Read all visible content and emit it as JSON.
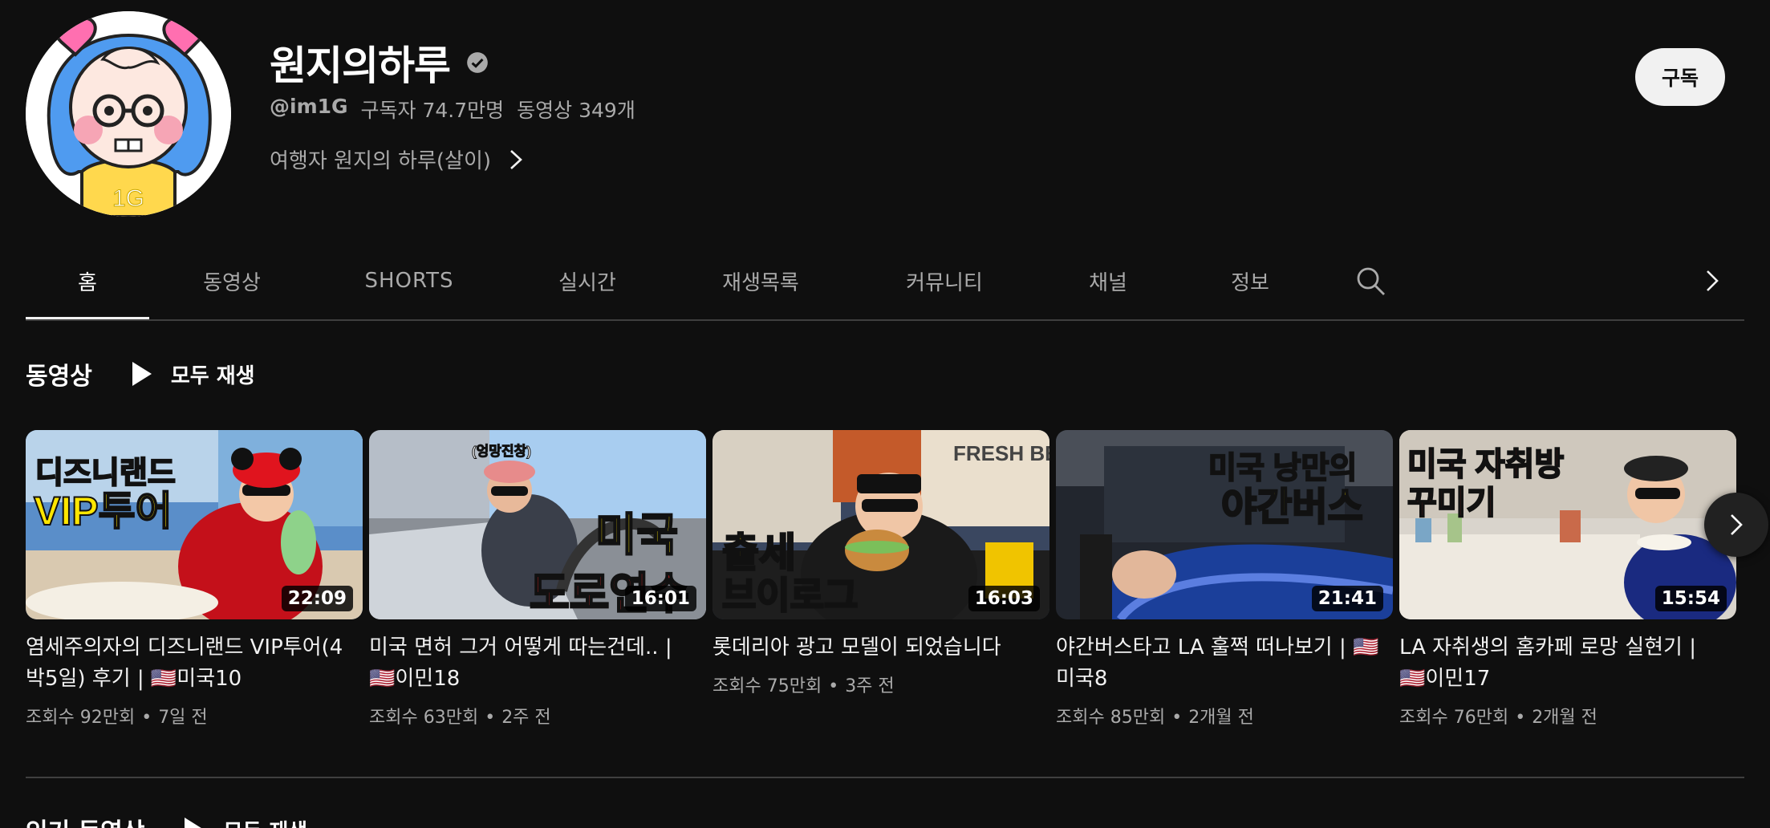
{
  "channel": {
    "name": "원지의하루",
    "handle": "@im1G",
    "subscribers": "구독자 74.7만명",
    "video_count": "동영상 349개",
    "description": "여행자 원지의 하루(살이)",
    "avatar_text": "1G",
    "subscribe_label": "구독"
  },
  "tabs": [
    {
      "label": "홈",
      "active": true
    },
    {
      "label": "동영상"
    },
    {
      "label": "SHORTS"
    },
    {
      "label": "실시간"
    },
    {
      "label": "재생목록"
    },
    {
      "label": "커뮤니티"
    },
    {
      "label": "채널"
    },
    {
      "label": "정보"
    }
  ],
  "section": {
    "title": "동영상",
    "play_all": "모두 재생"
  },
  "videos": [
    {
      "title": "염세주의자의 디즈니랜드 VIP투어(4박5일) 후기 | 🇺🇸미국10",
      "views": "조회수 92만회",
      "age": "7일 전",
      "duration": "22:09",
      "thumb_text": [
        "디즈니랜드",
        "VIP투어"
      ]
    },
    {
      "title": "미국 면허 그거 어떻게 따는건데.. | 🇺🇸이민18",
      "views": "조회수 63만회",
      "age": "2주 전",
      "duration": "16:01",
      "thumb_text": [
        "(엉망진창)",
        "미국",
        "도로연수"
      ]
    },
    {
      "title": "롯데리아 광고 모델이 되었습니다",
      "views": "조회수 75만회",
      "age": "3주 전",
      "duration": "16:03",
      "thumb_text": [
        "출세",
        "브이로그",
        "FRESH BEEF"
      ]
    },
    {
      "title": "야간버스타고 LA 훌쩍 떠나보기 | 🇺🇸미국8",
      "views": "조회수 85만회",
      "age": "2개월 전",
      "duration": "21:41",
      "thumb_text": [
        "미국 낭만의",
        "야간버스"
      ]
    },
    {
      "title": "LA 자취생의 홈카페 로망 실현기 | 🇺🇸이민17",
      "views": "조회수 76만회",
      "age": "2개월 전",
      "duration": "15:54",
      "thumb_text": [
        "미국 자취방",
        "꾸미기"
      ]
    }
  ],
  "section2": {
    "title": "인기 동영상",
    "play_all": "모두 재생"
  },
  "colors": {
    "background": "#0f0f0f",
    "text_primary": "#f1f1f1",
    "text_secondary": "#aaaaaa",
    "thumb_text_red": "#ff2a2a",
    "thumb_text_yellow": "#ffe600"
  }
}
